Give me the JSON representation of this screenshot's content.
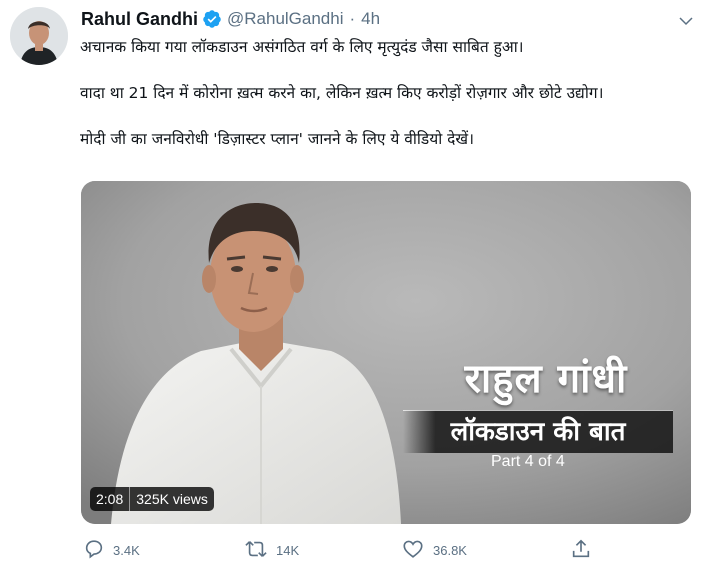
{
  "tweet": {
    "author_name": "Rahul Gandhi",
    "handle": "@RahulGandhi",
    "separator": "·",
    "time": "4h",
    "paragraphs": [
      "अचानक किया गया लॉकडाउन असंगठित वर्ग के लिए मृत्युदंड जैसा साबित हुआ।",
      "वादा था 21 दिन में कोरोना ख़त्म करने का, लेकिन ख़त्म किए करोड़ों रोज़गार और छोटे उद्योग।",
      "मोदी जी का जनविरोधी 'डिज़ास्टर प्लान' जानने के लिए ये वीडियो देखें।"
    ]
  },
  "media": {
    "title": "राहुल गांधी",
    "subtitle": "लॉकडाउन की बात",
    "part": "Part 4 of 4",
    "duration": "2:08",
    "views": "325K views"
  },
  "actions": {
    "replies": "3.4K",
    "retweets": "14K",
    "likes": "36.8K"
  },
  "colors": {
    "verified": "#1da1f2",
    "muted": "#5b7083",
    "text": "#0f1419"
  },
  "icons": [
    "verified-badge-icon",
    "chevron-down-icon",
    "reply-icon",
    "retweet-icon",
    "like-icon",
    "share-icon"
  ]
}
